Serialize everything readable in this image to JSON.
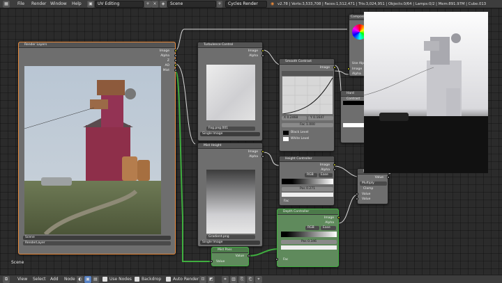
{
  "menu": {
    "items": [
      "File",
      "Render",
      "Window",
      "Help"
    ],
    "screen_layout": "UV Editing",
    "scene": "Scene",
    "engine": "Cycles Render",
    "info": "v2.78 | Verts:3,533,708 | Faces:1,512,471 | Tris:3,024,951 | Objects:0/64 | Lamps:0/2 | Mem:891.97M | Cube.013"
  },
  "nodes": {
    "render_layers": {
      "title": "Render Layers",
      "outputs": [
        "Image",
        "Alpha",
        "Z",
        "AO",
        "Mist"
      ],
      "scene": "Scene",
      "layer": "RenderLayer"
    },
    "turbulence": {
      "title": "Turbulence Control",
      "outputs": [
        "Image",
        "Alpha"
      ],
      "image_name": "Fog.png.001",
      "source": "Single Image"
    },
    "mist_height": {
      "title": "Mist Height",
      "outputs": [
        "Image",
        "Alpha"
      ],
      "image_name": "Gradient.png",
      "source": "Single Image"
    },
    "smooth_contrast": {
      "title": "Smooth Contrast",
      "output": "Image",
      "x_val": "X 0.2468",
      "y_val": "Y 0.1647",
      "fac_label": "Fac",
      "fac_val": "1.000",
      "black_level": "Black Level",
      "white_level": "White Level"
    },
    "hard_contrast": {
      "title": "Hard Contrast"
    },
    "height_controller": {
      "title": "Height Controller",
      "outputs": [
        "Image",
        "Alpha"
      ],
      "mode": "RGB",
      "interp": "Ease",
      "pos_label": "Pos",
      "pos_val": "0.271",
      "fac_label": "Fac"
    },
    "depth_controller": {
      "title": "Depth Controller",
      "outputs": [
        "Image",
        "Alpha"
      ],
      "mode": "RGB",
      "interp": "Ease",
      "pos_label": "Pos",
      "pos_val": "0.346",
      "fac_label": "Fac"
    },
    "multiply": {
      "title": "Multiply",
      "output": "Value",
      "op": "Multiply",
      "clamp": "Clamp",
      "inputs": [
        "Value",
        "Value"
      ]
    },
    "mist_pass": {
      "title": "Mist Pass",
      "output": "Value",
      "input": "Value"
    },
    "composite": {
      "title": "Composite",
      "use_alpha": "Use Alpha",
      "inputs": [
        "Image",
        "Alpha"
      ]
    }
  },
  "frame_label": "Scene",
  "bottom": {
    "items": [
      "View",
      "Select",
      "Add",
      "Node"
    ],
    "use_nodes": "Use Nodes",
    "backdrop": "Backdrop",
    "auto_render": "Auto Render"
  },
  "colors": {
    "accent": "#e8893a",
    "socket_yellow": "#c7c729",
    "socket_gray": "#a1a1a1",
    "frame_green": "#3fae3f"
  }
}
